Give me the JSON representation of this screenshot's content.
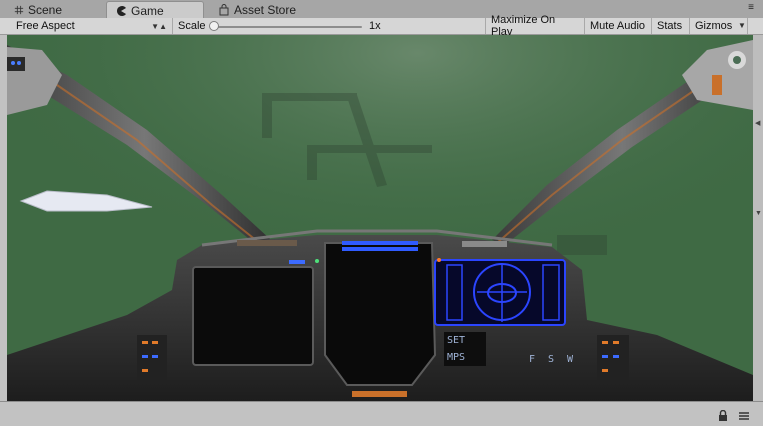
{
  "tabs": [
    {
      "label": "Scene",
      "icon": "grid-icon",
      "active": false
    },
    {
      "label": "Game",
      "icon": "pacman-icon",
      "active": true
    },
    {
      "label": "Asset Store",
      "icon": "bag-icon",
      "active": false
    }
  ],
  "toolbar": {
    "aspect": "Free Aspect",
    "scale_label": "Scale",
    "scale_value": "1x",
    "scale_level": 0.0,
    "maximize": "Maximize On Play",
    "mute": "Mute Audio",
    "stats": "Stats",
    "gizmos": "Gizmos"
  },
  "game": {
    "hud_labels": [
      "SET",
      "MPS"
    ],
    "hud_letters": [
      "F",
      "S",
      "W"
    ],
    "background_color": "#3f6a44",
    "hud_accent": "#2b45ff"
  }
}
